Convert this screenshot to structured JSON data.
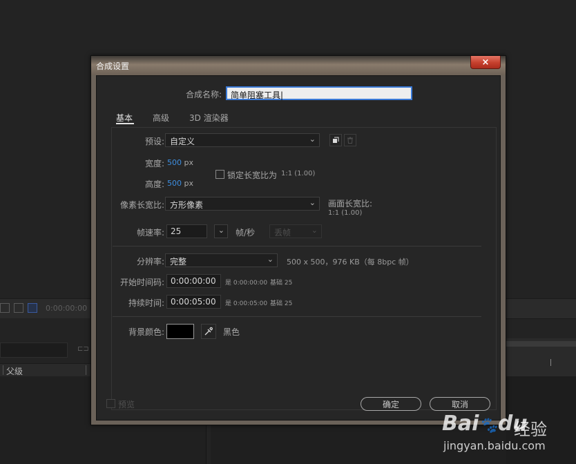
{
  "background": {
    "timecode": "0:00:00:00",
    "column_parent": "父级"
  },
  "dialog": {
    "title": "合成设置",
    "close_label": "×",
    "comp_name_label": "合成名称:",
    "comp_name_value": "简单阻塞工具",
    "tabs": [
      "基本",
      "高级",
      "3D 渲染器"
    ],
    "preset_label": "预设:",
    "preset_value": "自定义",
    "width_label": "宽度:",
    "width_value": "500",
    "height_label": "高度:",
    "height_value": "500",
    "unit_px": "px",
    "lock_ratio_label": "锁定长宽比为",
    "lock_ratio_value": "1:1 (1.00)",
    "pixel_aspect_label": "像素长宽比:",
    "pixel_aspect_value": "方形像素",
    "frame_aspect_label": "画面长宽比:",
    "frame_aspect_value": "1:1 (1.00)",
    "frame_rate_label": "帧速率:",
    "frame_rate_value": "25",
    "frame_rate_unit": "帧/秒",
    "drop_frame_value": "丢帧",
    "resolution_label": "分辨率:",
    "resolution_value": "完整",
    "resolution_info": "500 x 500，976 KB（每 8bpc 帧）",
    "start_tc_label": "开始时间码:",
    "start_tc_value": "0:00:00:00",
    "start_tc_note": "是 0:00:00:00",
    "start_tc_base": "基础 25",
    "duration_label": "持续时间:",
    "duration_value": "0:00:05:00",
    "duration_note": "是 0:00:05:00",
    "duration_base": "基础 25",
    "bg_color_label": "背景颜色:",
    "bg_color_name": "黑色",
    "bg_color_hex": "#000000",
    "preview_label": "预览",
    "ok_label": "确定",
    "cancel_label": "取消"
  },
  "watermark": {
    "brand": "Bai",
    "brand2": "du",
    "product": "经验",
    "url": "jingyan.baidu.com"
  }
}
